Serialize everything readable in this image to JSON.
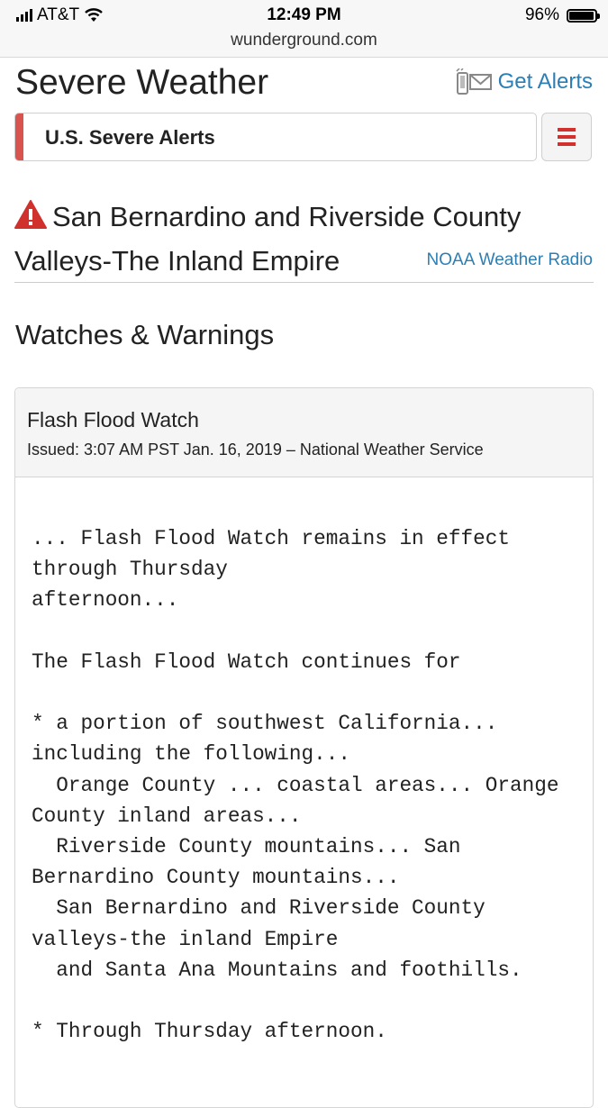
{
  "status_bar": {
    "carrier": "AT&T",
    "time": "12:49 PM",
    "battery": "96%",
    "battery_level": 0.96
  },
  "browser": {
    "url": "wunderground.com"
  },
  "header": {
    "title": "Severe Weather",
    "get_alerts": "Get Alerts"
  },
  "alerts_selector": {
    "label": "U.S. Severe Alerts"
  },
  "region": {
    "title": "San Bernardino and Riverside County Valleys-The Inland Empire",
    "noaa_link": "NOAA Weather Radio"
  },
  "section": {
    "title": "Watches & Warnings"
  },
  "warning": {
    "title": "Flash Flood Watch",
    "issued": "Issued: 3:07 AM PST Jan. 16, 2019 – National Weather Service",
    "lines": [
      "... Flash Flood Watch remains in effect",
      "through Thursday",
      "afternoon...",
      "",
      "The Flash Flood Watch continues for",
      "",
      "* a portion of southwest California...",
      "including the following...",
      "  Orange County ... coastal areas... Orange",
      "County inland areas...",
      "  Riverside County mountains... San",
      "Bernardino County mountains...",
      "  San Bernardino and Riverside County",
      "valleys-the inland Empire",
      "  and Santa Ana Mountains and foothills.",
      "",
      "* Through Thursday afternoon."
    ]
  },
  "colors": {
    "link": "#2b7fb5",
    "alert_red": "#d9534f",
    "menu_red": "#d0312d"
  }
}
